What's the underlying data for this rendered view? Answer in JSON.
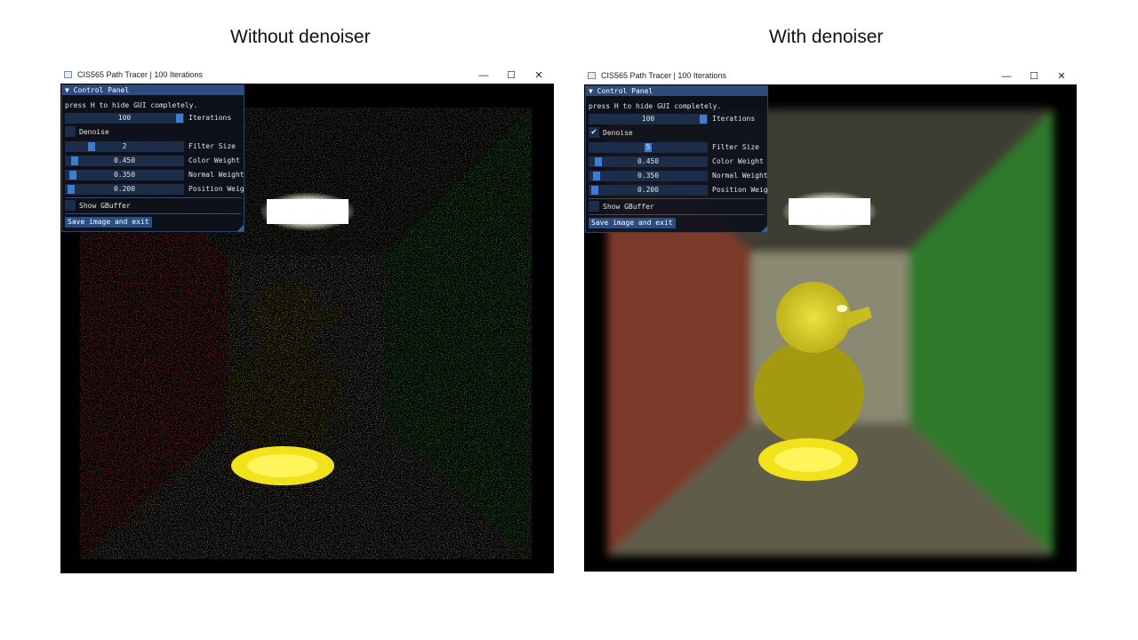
{
  "headings": {
    "left": "Without denoiser",
    "right": "With denoiser"
  },
  "windows": [
    {
      "title": "CIS565 Path Tracer | 100 Iterations",
      "controls": {
        "minimize": "—",
        "maximize": "☐",
        "close": "✕"
      },
      "scene_noisy": true,
      "panel": {
        "header": "▼ Control Panel",
        "hint": "press H to hide GUI completely.",
        "iterations": {
          "value": "100",
          "label": "Iterations",
          "fraction": 1.0
        },
        "denoise": {
          "label": "Denoise",
          "checked": false,
          "mark": ""
        },
        "filter_size": {
          "value": "2",
          "label": "Filter Size",
          "fraction": 0.2
        },
        "color_weight": {
          "value": "0.450",
          "label": "Color Weight",
          "fraction": 0.045
        },
        "normal_weight": {
          "value": "0.350",
          "label": "Normal Weight",
          "fraction": 0.035
        },
        "position_weight": {
          "value": "0.200",
          "label": "Position Weig",
          "fraction": 0.02
        },
        "show_gbuffer": {
          "label": "Show GBuffer",
          "checked": false
        },
        "save_button": "Save image and exit"
      }
    },
    {
      "title": "CIS565 Path Tracer | 100 Iterations",
      "controls": {
        "minimize": "—",
        "maximize": "☐",
        "close": "✕"
      },
      "scene_noisy": false,
      "panel": {
        "header": "▼ Control Panel",
        "hint": "press H to hide GUI completely.",
        "iterations": {
          "value": "100",
          "label": "Iterations",
          "fraction": 1.0
        },
        "denoise": {
          "label": "Denoise",
          "checked": true,
          "mark": "✔"
        },
        "filter_size": {
          "value": "5",
          "label": "Filter Size",
          "fraction": 0.5
        },
        "color_weight": {
          "value": "0.450",
          "label": "Color Weight",
          "fraction": 0.045
        },
        "normal_weight": {
          "value": "0.350",
          "label": "Normal Weight",
          "fraction": 0.035
        },
        "position_weight": {
          "value": "0.200",
          "label": "Position Weig",
          "fraction": 0.02
        },
        "show_gbuffer": {
          "label": "Show GBuffer",
          "checked": false
        },
        "save_button": "Save image and exit"
      }
    }
  ],
  "colors": {
    "panel_header": "#2d4c7d",
    "slider_bg": "#1b2d49",
    "slider_grab": "#3e7cd2",
    "wall_left": "#b8463a",
    "wall_right": "#3fa53a",
    "duck": "#d9cc1a"
  },
  "icons": {
    "app": "window-app-icon",
    "minimize": "minimize-icon",
    "maximize": "maximize-icon",
    "close": "close-icon"
  }
}
